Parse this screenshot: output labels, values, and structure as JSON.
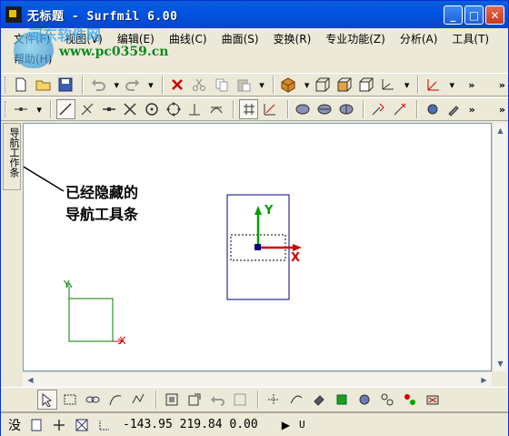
{
  "window": {
    "title": "无标题 - Surfmil 6.00",
    "minimize_label": "_",
    "maximize_label": "□",
    "close_label": "✕"
  },
  "watermark": {
    "title": "河东软件网",
    "url": "www.pc0359.cn"
  },
  "menu": {
    "items": [
      "文件(F)",
      "视图(V)",
      "编辑(E)",
      "曲线(C)",
      "曲面(S)",
      "变换(R)",
      "专业功能(Z)",
      "分析(A)",
      "工具(T)"
    ],
    "help": "帮助(H)"
  },
  "toolbar1": {
    "icons": [
      "new-file-icon",
      "open-folder-icon",
      "save-icon",
      "undo-icon",
      "redo-icon",
      "delete-icon",
      "cut-icon",
      "copy-icon",
      "paste-icon",
      "shaded-cube-icon",
      "wire-cube-icon",
      "solid-cube-icon",
      "front-cube-icon",
      "axis-view-icon",
      "coordinate-icon"
    ]
  },
  "toolbar2": {
    "icons": [
      "snap-icon",
      "line-icon",
      "angle-line-icon",
      "horizontal-line-icon",
      "cross-icon",
      "circle-icon",
      "quadrant-icon",
      "perpendicular-icon",
      "tangent-icon",
      "grid-icon",
      "axis-grid-icon",
      "surface-a-icon",
      "surface-b-icon",
      "surface-c-icon",
      "point-a-icon",
      "point-b-icon",
      "tool-a-icon",
      "tool-b-icon"
    ]
  },
  "side_tab": {
    "label": "导航工作条"
  },
  "annotation": {
    "line1": "已经隐藏的",
    "line2": "导航工具条"
  },
  "canvas": {
    "axis_labels": {
      "y": "Y",
      "x": "X"
    },
    "colors": {
      "axis_y": "#00a000",
      "axis_x": "#d00000",
      "frame": "#000080",
      "small_frame": "#008000"
    }
  },
  "toolbar3": {
    "icons": [
      "select-arrow-icon",
      "rect-select-icon",
      "chain-select-icon",
      "curve-select-icon",
      "multi-select-icon",
      "window-fit-icon",
      "window-zoom-icon",
      "prev-view-icon",
      "region-icon",
      "point-tool-icon",
      "trim-icon",
      "rotate-icon",
      "green-box-icon",
      "gear-view-icon",
      "node-icon",
      "cluster-icon",
      "snapshot-icon"
    ]
  },
  "status": {
    "prefix": "没",
    "coordinates": "-143.95 219.84 0.00",
    "play_label": "▶",
    "mode": "U"
  }
}
